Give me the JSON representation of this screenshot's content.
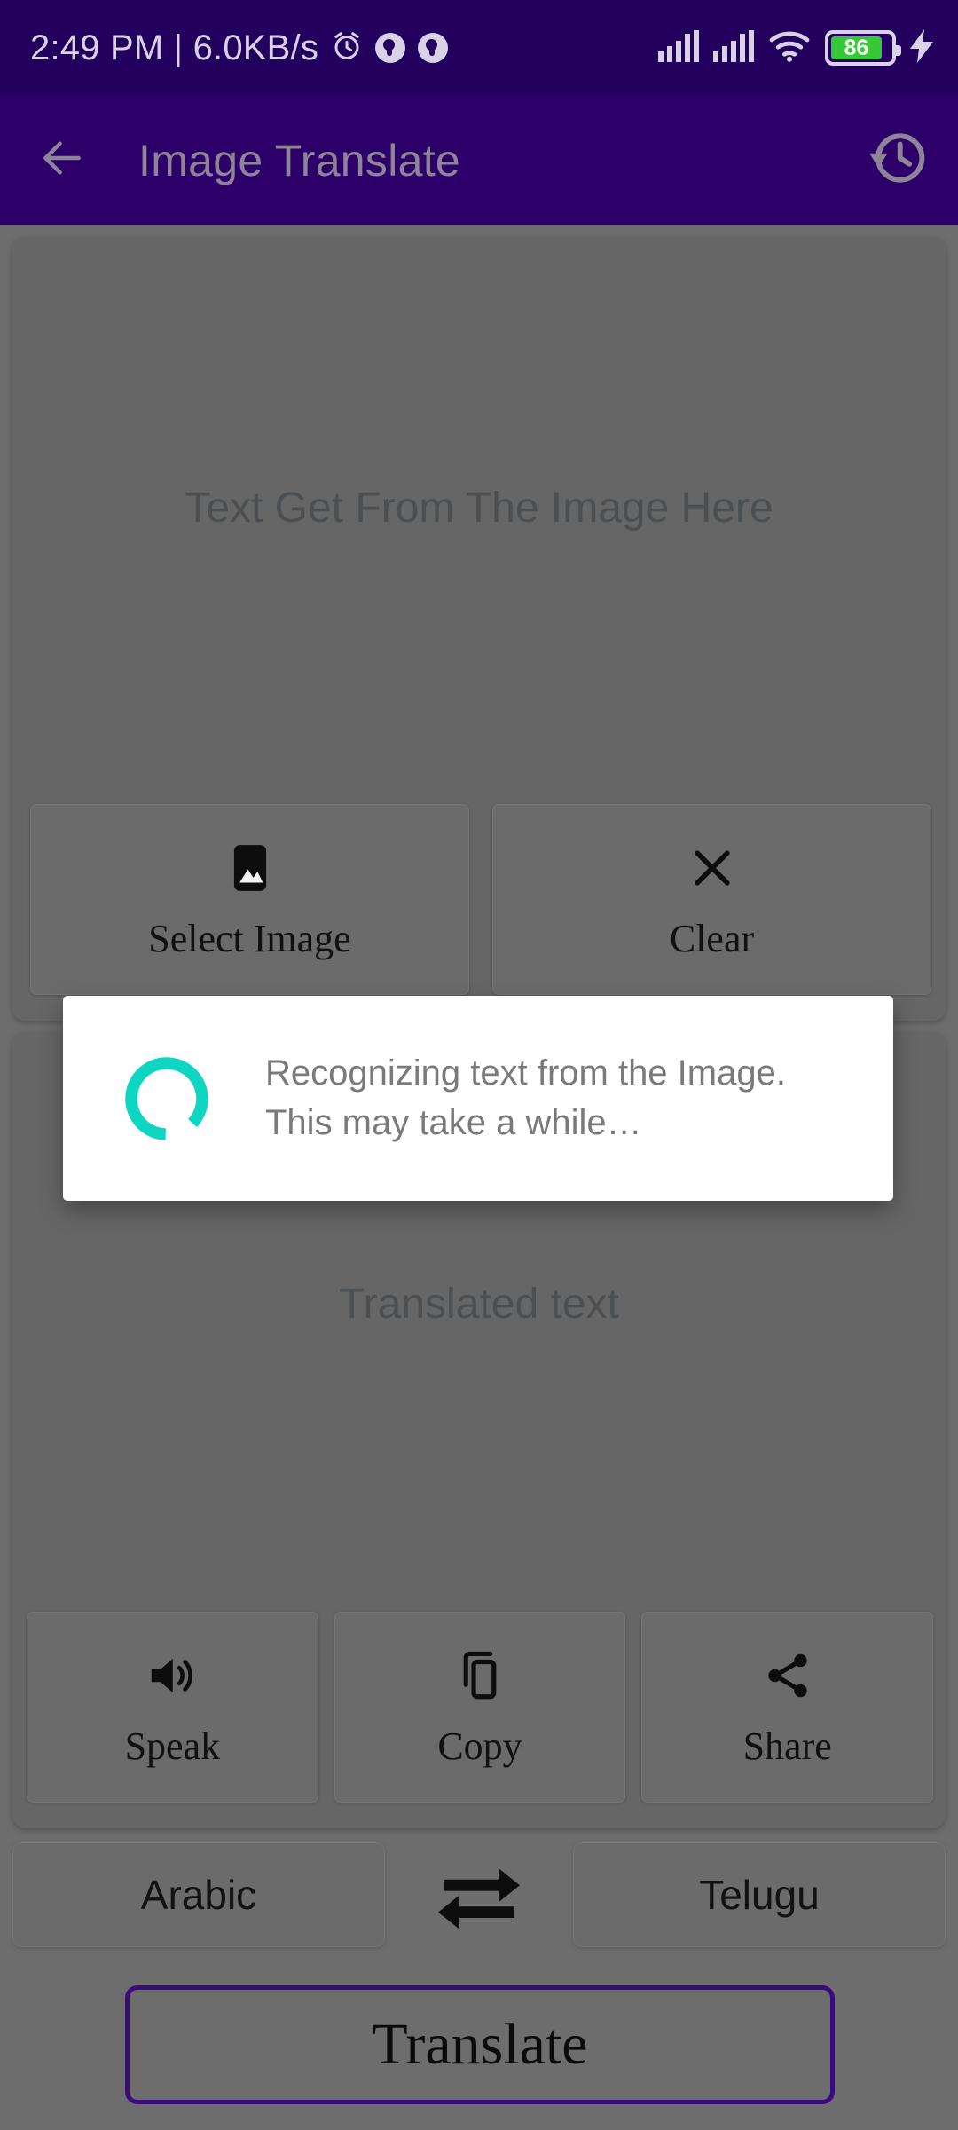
{
  "status_bar": {
    "clock_and_net": "2:49 PM | 6.0KB/s",
    "alarm_icon": "alarm-clock-icon",
    "notification_icons": [
      "app-notification-icon",
      "app-notification-icon"
    ],
    "signal_icon_1": "cellular-signal-icon",
    "signal_icon_2": "cellular-signal-icon",
    "wifi_icon": "wifi-icon",
    "battery_level": "86",
    "charging_icon": "charging-bolt-icon",
    "bg_color": "#23005e"
  },
  "app_bar": {
    "back_icon": "back-arrow-icon",
    "title": "Image Translate",
    "history_icon": "history-clock-icon",
    "bg_color": "#2c0068",
    "title_color": "#8d8499"
  },
  "source_card": {
    "placeholder": "Text Get From The Image Here",
    "actions": [
      {
        "label": "Select Image",
        "icon": "image-picture-icon"
      },
      {
        "label": "Clear",
        "icon": "close-x-icon"
      }
    ]
  },
  "target_card": {
    "placeholder": "Translated text",
    "actions": [
      {
        "label": "Speak",
        "icon": "volume-speaker-icon"
      },
      {
        "label": "Copy",
        "icon": "copy-duplicate-icon"
      },
      {
        "label": "Share",
        "icon": "share-nodes-icon"
      }
    ]
  },
  "language_row": {
    "source_language": "Arabic",
    "swap_icon": "swap-arrows-icon",
    "target_language": "Telugu"
  },
  "translate_button": {
    "label": "Translate",
    "border_color": "#3a0b7d"
  },
  "dialog": {
    "spinner_icon": "loading-spinner-icon",
    "spinner_color": "#0fd6c2",
    "message": "Recognizing text from the Image.\nThis may take a while…",
    "bg_color": "#ffffff"
  }
}
